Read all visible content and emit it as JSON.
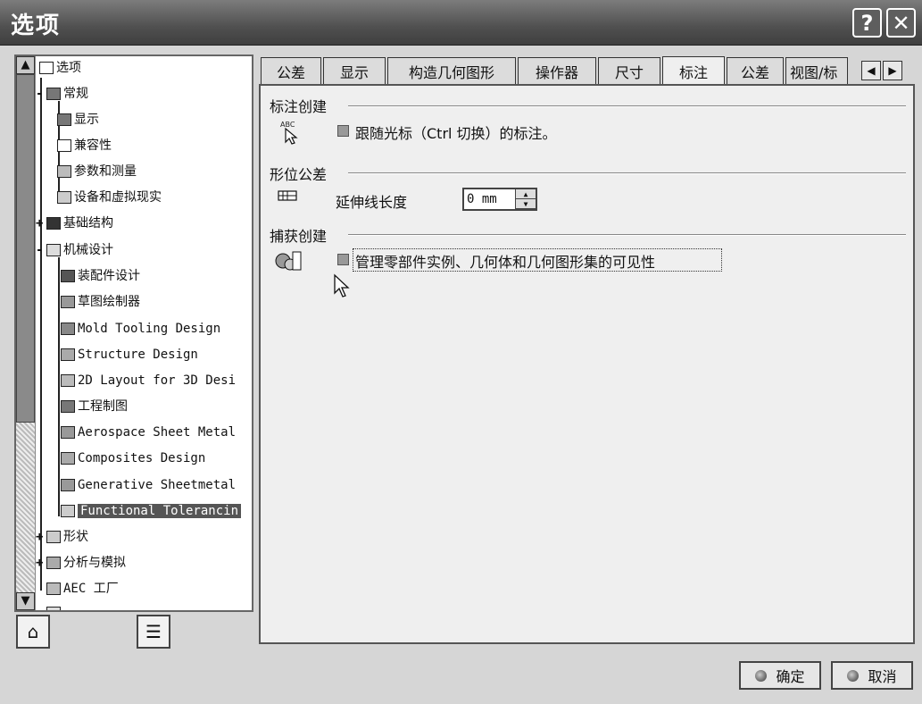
{
  "window": {
    "title": "选项",
    "help_glyph": "?",
    "close_glyph": "✕"
  },
  "tree": {
    "items": [
      {
        "label": "选项",
        "icon": "options-root-icon"
      },
      {
        "label": "常规",
        "icon": "general-icon"
      },
      {
        "label": "显示",
        "icon": "display-icon"
      },
      {
        "label": "兼容性",
        "icon": "compatibility-icon"
      },
      {
        "label": "参数和测量",
        "icon": "parameters-icon"
      },
      {
        "label": "设备和虚拟现实",
        "icon": "devices-icon"
      },
      {
        "label": "基础结构",
        "icon": "infrastructure-icon"
      },
      {
        "label": "机械设计",
        "icon": "mechanical-design-icon"
      },
      {
        "label": "装配件设计",
        "icon": "assembly-design-icon"
      },
      {
        "label": "草图绘制器",
        "icon": "sketcher-icon"
      },
      {
        "label": "Mold Tooling Design",
        "icon": "mold-tooling-icon"
      },
      {
        "label": "Structure Design",
        "icon": "structure-design-icon"
      },
      {
        "label": "2D Layout for 3D Desi",
        "icon": "layout-2d-icon"
      },
      {
        "label": "工程制图",
        "icon": "drafting-icon"
      },
      {
        "label": "Aerospace Sheet Metal",
        "icon": "aerospace-sheetmetal-icon"
      },
      {
        "label": "Composites Design",
        "icon": "composites-icon"
      },
      {
        "label": "Generative Sheetmetal",
        "icon": "generative-sheetmetal-icon"
      },
      {
        "label": "Functional Tolerancin",
        "icon": "functional-tolerancing-icon"
      },
      {
        "label": "形状",
        "icon": "shape-icon"
      },
      {
        "label": "分析与模拟",
        "icon": "analysis-icon"
      },
      {
        "label": "AEC 工厂",
        "icon": "aec-plant-icon"
      },
      {
        "label": "…",
        "icon": "partial-item-icon"
      }
    ],
    "selected_index": 17
  },
  "tabs": [
    "公差",
    "显示",
    "构造几何图形",
    "操作器",
    "尺寸",
    "标注",
    "公差",
    "视图/标"
  ],
  "active_tab_index": 5,
  "content": {
    "annotation_section": {
      "title": "标注创建",
      "follow_cursor_label": "跟随光标（Ctrl 切换）的标注。"
    },
    "gdt_section": {
      "title": "形位公差",
      "extension_label": "延伸线长度",
      "extension_value": "0 mm"
    },
    "capture_section": {
      "title": "捕获创建",
      "visibility_label": "管理零部件实例、几何体和几何图形集的可见性"
    }
  },
  "buttons": {
    "ok": "确定",
    "cancel": "取消"
  }
}
